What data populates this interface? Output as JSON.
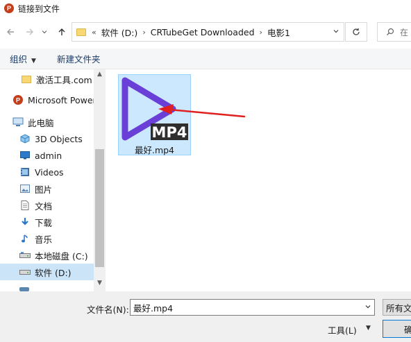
{
  "window": {
    "title": "链接到文件",
    "app_icon_letter": "P"
  },
  "address": {
    "overflow": "«",
    "crumbs": [
      "软件 (D:)",
      "CRTubeGet Downloaded",
      "电影1"
    ],
    "separator": "›",
    "search_placeholder": "在"
  },
  "toolbar": {
    "organize_label": "组织",
    "new_folder_label": "新建文件夹"
  },
  "sidebar": {
    "items": [
      {
        "label": "激活工具.com",
        "icon": "folder-icon"
      },
      {
        "label": "Microsoft Power",
        "icon": "powerpoint-icon"
      },
      {
        "label": "此电脑",
        "icon": "computer-icon"
      },
      {
        "label": "3D Objects",
        "icon": "cube-icon"
      },
      {
        "label": "admin",
        "icon": "desktop-icon"
      },
      {
        "label": "Videos",
        "icon": "video-icon"
      },
      {
        "label": "图片",
        "icon": "picture-icon"
      },
      {
        "label": "文档",
        "icon": "document-icon"
      },
      {
        "label": "下载",
        "icon": "download-icon"
      },
      {
        "label": "音乐",
        "icon": "music-icon"
      },
      {
        "label": "本地磁盘 (C:)",
        "icon": "drive-icon"
      },
      {
        "label": "软件 (D:)",
        "icon": "drive-icon",
        "selected": true
      }
    ]
  },
  "files": [
    {
      "name": "最好.mp4",
      "badge": "MP4",
      "selected": true
    }
  ],
  "bottom": {
    "filename_label": "文件名(N):",
    "filename_value": "最好.mp4",
    "filter_label": "所有文",
    "tools_label": "工具(L)",
    "open_label": "确"
  },
  "colors": {
    "selection": "#cce4f7",
    "file_selection": "#cce8ff",
    "play_icon_purple": "#6a3fd8",
    "arrow_red": "#e0201e",
    "panel_gray": "#f0f0f0"
  }
}
